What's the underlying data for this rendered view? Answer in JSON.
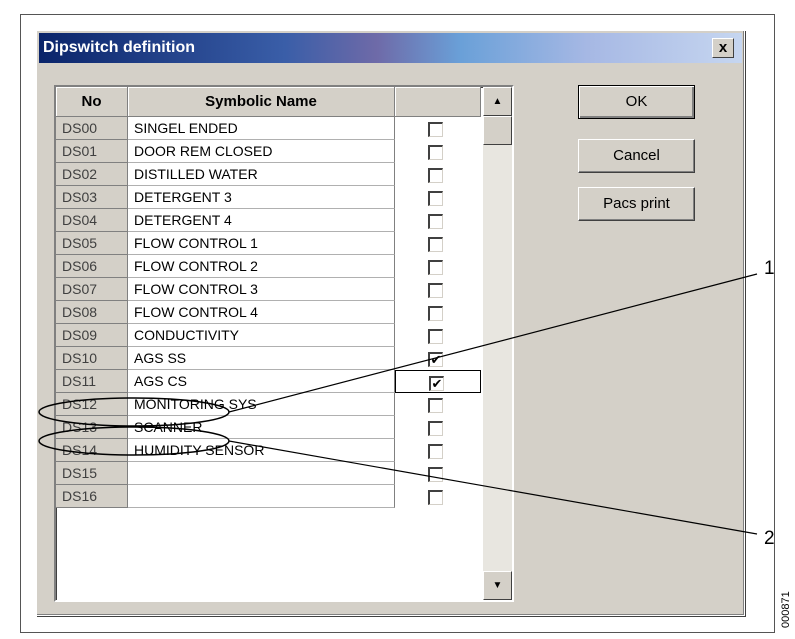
{
  "dialog": {
    "title": "Dipswitch definition",
    "close_label": "x"
  },
  "grid": {
    "headers": {
      "no": "No",
      "name": "Symbolic Name",
      "check": ""
    },
    "rows": [
      {
        "no": "DS00",
        "name": "SINGEL ENDED",
        "checked": false
      },
      {
        "no": "DS01",
        "name": "DOOR REM CLOSED",
        "checked": false
      },
      {
        "no": "DS02",
        "name": "DISTILLED WATER",
        "checked": false
      },
      {
        "no": "DS03",
        "name": "DETERGENT 3",
        "checked": false
      },
      {
        "no": "DS04",
        "name": "DETERGENT 4",
        "checked": false
      },
      {
        "no": "DS05",
        "name": "FLOW CONTROL 1",
        "checked": false
      },
      {
        "no": "DS06",
        "name": "FLOW CONTROL 2",
        "checked": false
      },
      {
        "no": "DS07",
        "name": "FLOW CONTROL 3",
        "checked": false
      },
      {
        "no": "DS08",
        "name": "FLOW CONTROL 4",
        "checked": false
      },
      {
        "no": "DS09",
        "name": "CONDUCTIVITY",
        "checked": false
      },
      {
        "no": "DS10",
        "name": "AGS SS",
        "checked": true
      },
      {
        "no": "DS11",
        "name": "AGS CS",
        "checked": true
      },
      {
        "no": "DS12",
        "name": "MONITORING SYS",
        "checked": false
      },
      {
        "no": "DS13",
        "name": "SCANNER",
        "checked": false
      },
      {
        "no": "DS14",
        "name": "HUMIDITY SENSOR",
        "checked": false
      },
      {
        "no": "DS15",
        "name": "",
        "checked": false
      },
      {
        "no": "DS16",
        "name": "",
        "checked": false
      }
    ],
    "focused_row": 11,
    "check_glyph": "✔",
    "scroll_up_glyph": "▲",
    "scroll_down_glyph": "▼"
  },
  "buttons": {
    "ok": "OK",
    "cancel": "Cancel",
    "pacs_print": "Pacs print"
  },
  "callouts": {
    "one": "1",
    "two": "2"
  },
  "figure_id": "000871",
  "colors": {
    "face": "#d4d0c8",
    "title_start": "#0a246a",
    "title_end": "#c6d6f0"
  }
}
